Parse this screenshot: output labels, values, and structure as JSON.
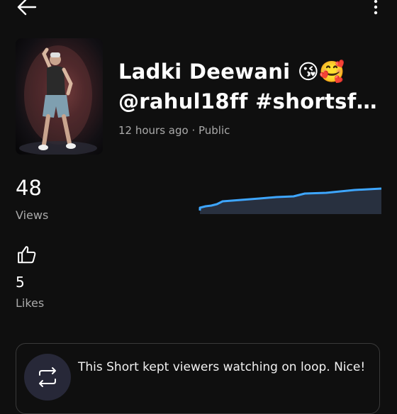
{
  "video": {
    "title_line1": "Ladki Deewani 😘🥰",
    "title_line2": "@rahul18ff #shortsfe...",
    "meta": "12 hours ago · Public"
  },
  "stats": {
    "views_count": "48",
    "views_label": "Views",
    "likes_count": "5",
    "likes_label": "Likes"
  },
  "insight": {
    "text": "This Short kept viewers watching on loop. Nice!"
  },
  "icons": {
    "back": "arrow-left-icon",
    "more": "more-vert-icon",
    "like": "thumbs-up-icon",
    "loop": "repeat-icon"
  },
  "colors": {
    "background": "#0f0f0f",
    "accent_line": "#3ea6ff",
    "secondary_text": "#aaaaaa"
  }
}
